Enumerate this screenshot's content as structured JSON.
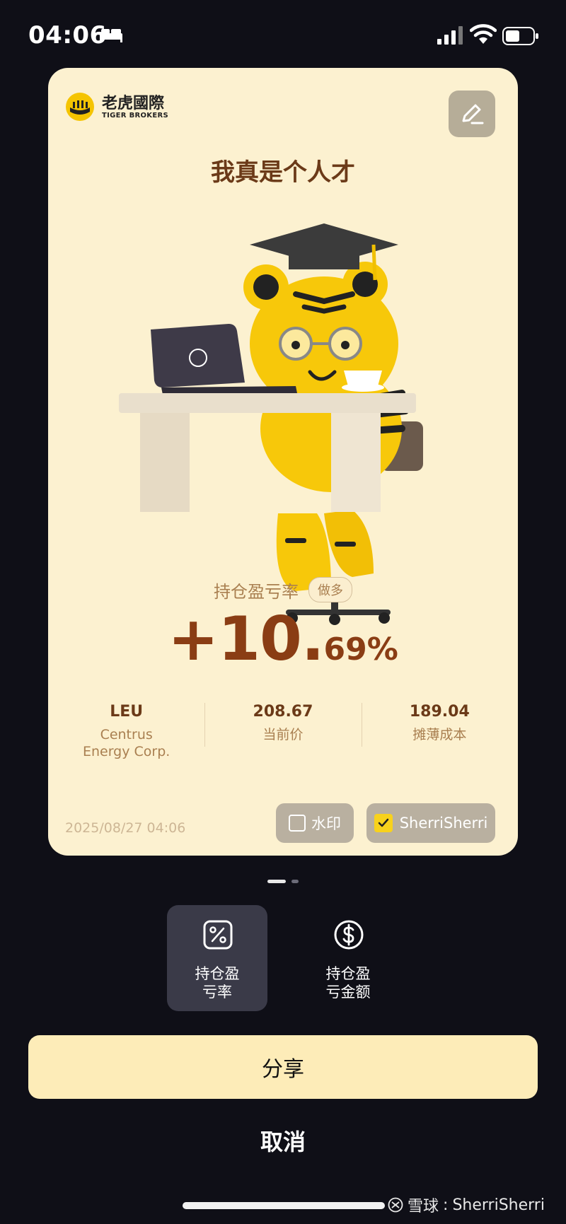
{
  "status_bar": {
    "time": "04:06"
  },
  "card": {
    "logo_cn": "老虎國際",
    "logo_en": "TIGER BROKERS",
    "title": "我真是个人才",
    "metric_label": "持仓盈亏率",
    "direction_badge": "做多",
    "return_main": "+10.",
    "return_decimal": "69%",
    "stats": [
      {
        "value": "LEU",
        "label": "Centrus\nEnergy Corp."
      },
      {
        "value": "208.67",
        "label": "当前价"
      },
      {
        "value": "189.04",
        "label": "摊薄成本"
      }
    ],
    "timestamp": "2025/08/27 04:06",
    "watermark_label": "水印",
    "watermark_checked": false,
    "username_label": "SherriSherri",
    "username_checked": true
  },
  "page_indicator": {
    "total": 2,
    "current": 1
  },
  "style_options": [
    {
      "label": "持仓盈\n亏率",
      "icon": "percent-icon",
      "selected": true
    },
    {
      "label": "持仓盈\n亏金额",
      "icon": "dollar-icon",
      "selected": false
    }
  ],
  "actions": {
    "share_label": "分享",
    "cancel_label": "取消"
  },
  "footer_watermark": {
    "brand": "雪球",
    "separator": ":",
    "user": "SherriSherri"
  },
  "colors": {
    "card_bg": "#fcf1d0",
    "title_brown": "#6b3a18",
    "return_brown": "#8a3d14",
    "muted_brown": "#a97f50",
    "share_button_bg": "#fdecb8",
    "check_yellow": "#f8d21c",
    "page_bg": "#0f0f17"
  }
}
